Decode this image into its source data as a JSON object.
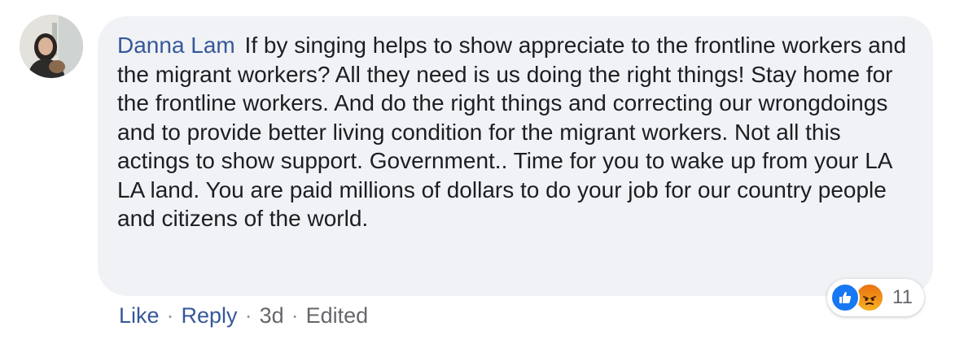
{
  "comment": {
    "author": "Danna Lam",
    "text": "If by singing helps to show appreciate to the frontline workers and the migrant workers? All they need is us doing the right things! Stay home for the frontline workers. And do the right things and correcting our wrongdoings and to provide better living condition for the migrant workers. Not all this actings to show support. Government.. Time for you to wake up from your LA LA land. You are paid millions of dollars to do your job for our country people and citizens of the world."
  },
  "reactions": {
    "icons": [
      "like-icon",
      "angry-icon"
    ],
    "count": "11"
  },
  "actions": {
    "like_label": "Like",
    "reply_label": "Reply",
    "time": "3d",
    "edited_label": "Edited",
    "separator": "·"
  },
  "colors": {
    "author_link": "#365899",
    "bubble_bg": "#f0f2f5",
    "text": "#1c1e21",
    "like_blue": "#1877f2",
    "angry_orange": "#e9710f"
  }
}
